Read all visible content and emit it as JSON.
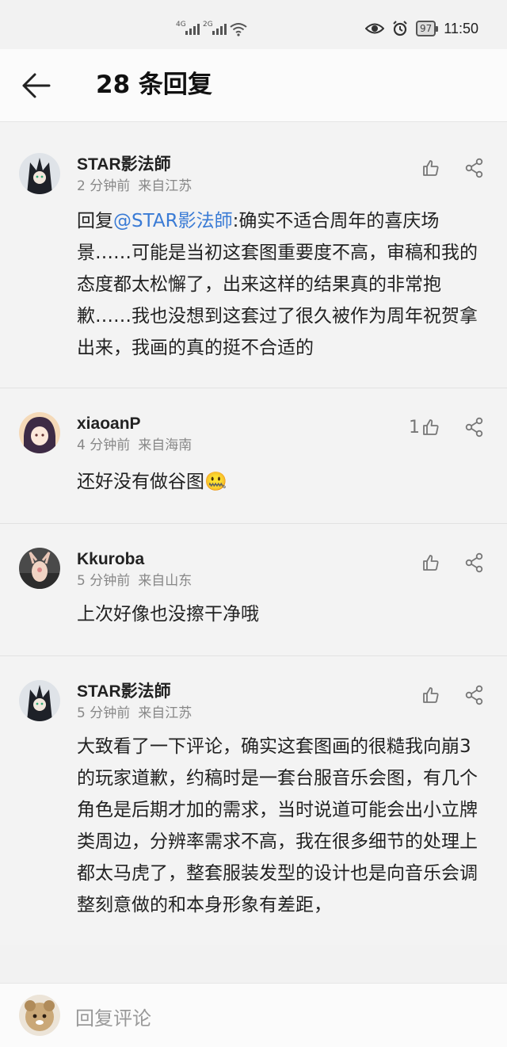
{
  "status_bar": {
    "signal1_label": "4G",
    "signal2_label": "2G",
    "battery": "97",
    "time": "11:50",
    "icons": [
      "eye-icon",
      "alarm-icon",
      "wifi-icon"
    ]
  },
  "header": {
    "title": "28 条回复",
    "back_icon": "arrow-left-icon"
  },
  "comments": [
    {
      "username": "STAR影法師",
      "time": "2 分钟前",
      "location": "来自江苏",
      "likes": "",
      "reply_prefix": "回复",
      "mention": "@STAR影法師",
      "text": ":确实不适合周年的喜庆场景……可能是当初这套图重要度不高，审稿和我的态度都太松懈了，出来这样的结果真的非常抱歉……我也没想到这套过了很久被作为周年祝贺拿出来，我画的真的挺不合适的"
    },
    {
      "username": "xiaoanP",
      "time": "4 分钟前",
      "location": "来自海南",
      "likes": "1",
      "text": "还好没有做谷图🤐"
    },
    {
      "username": "Kkuroba",
      "time": "5 分钟前",
      "location": "来自山东",
      "likes": "",
      "text": "上次好像也没擦干净哦"
    },
    {
      "username": "STAR影法師",
      "time": "5 分钟前",
      "location": "来自江苏",
      "likes": "",
      "text": "大致看了一下评论，确实这套图画的很糙我向崩3的玩家道歉，约稿时是一套台服音乐会图，有几个角色是后期才加的需求，当时说道可能会出小立牌类周边，分辨率需求不高，我在很多细节的处理上都太马虎了，整套服装发型的设计也是向音乐会调整刻意做的和本身形象有差距，"
    }
  ],
  "footer": {
    "placeholder": "回复评论"
  }
}
